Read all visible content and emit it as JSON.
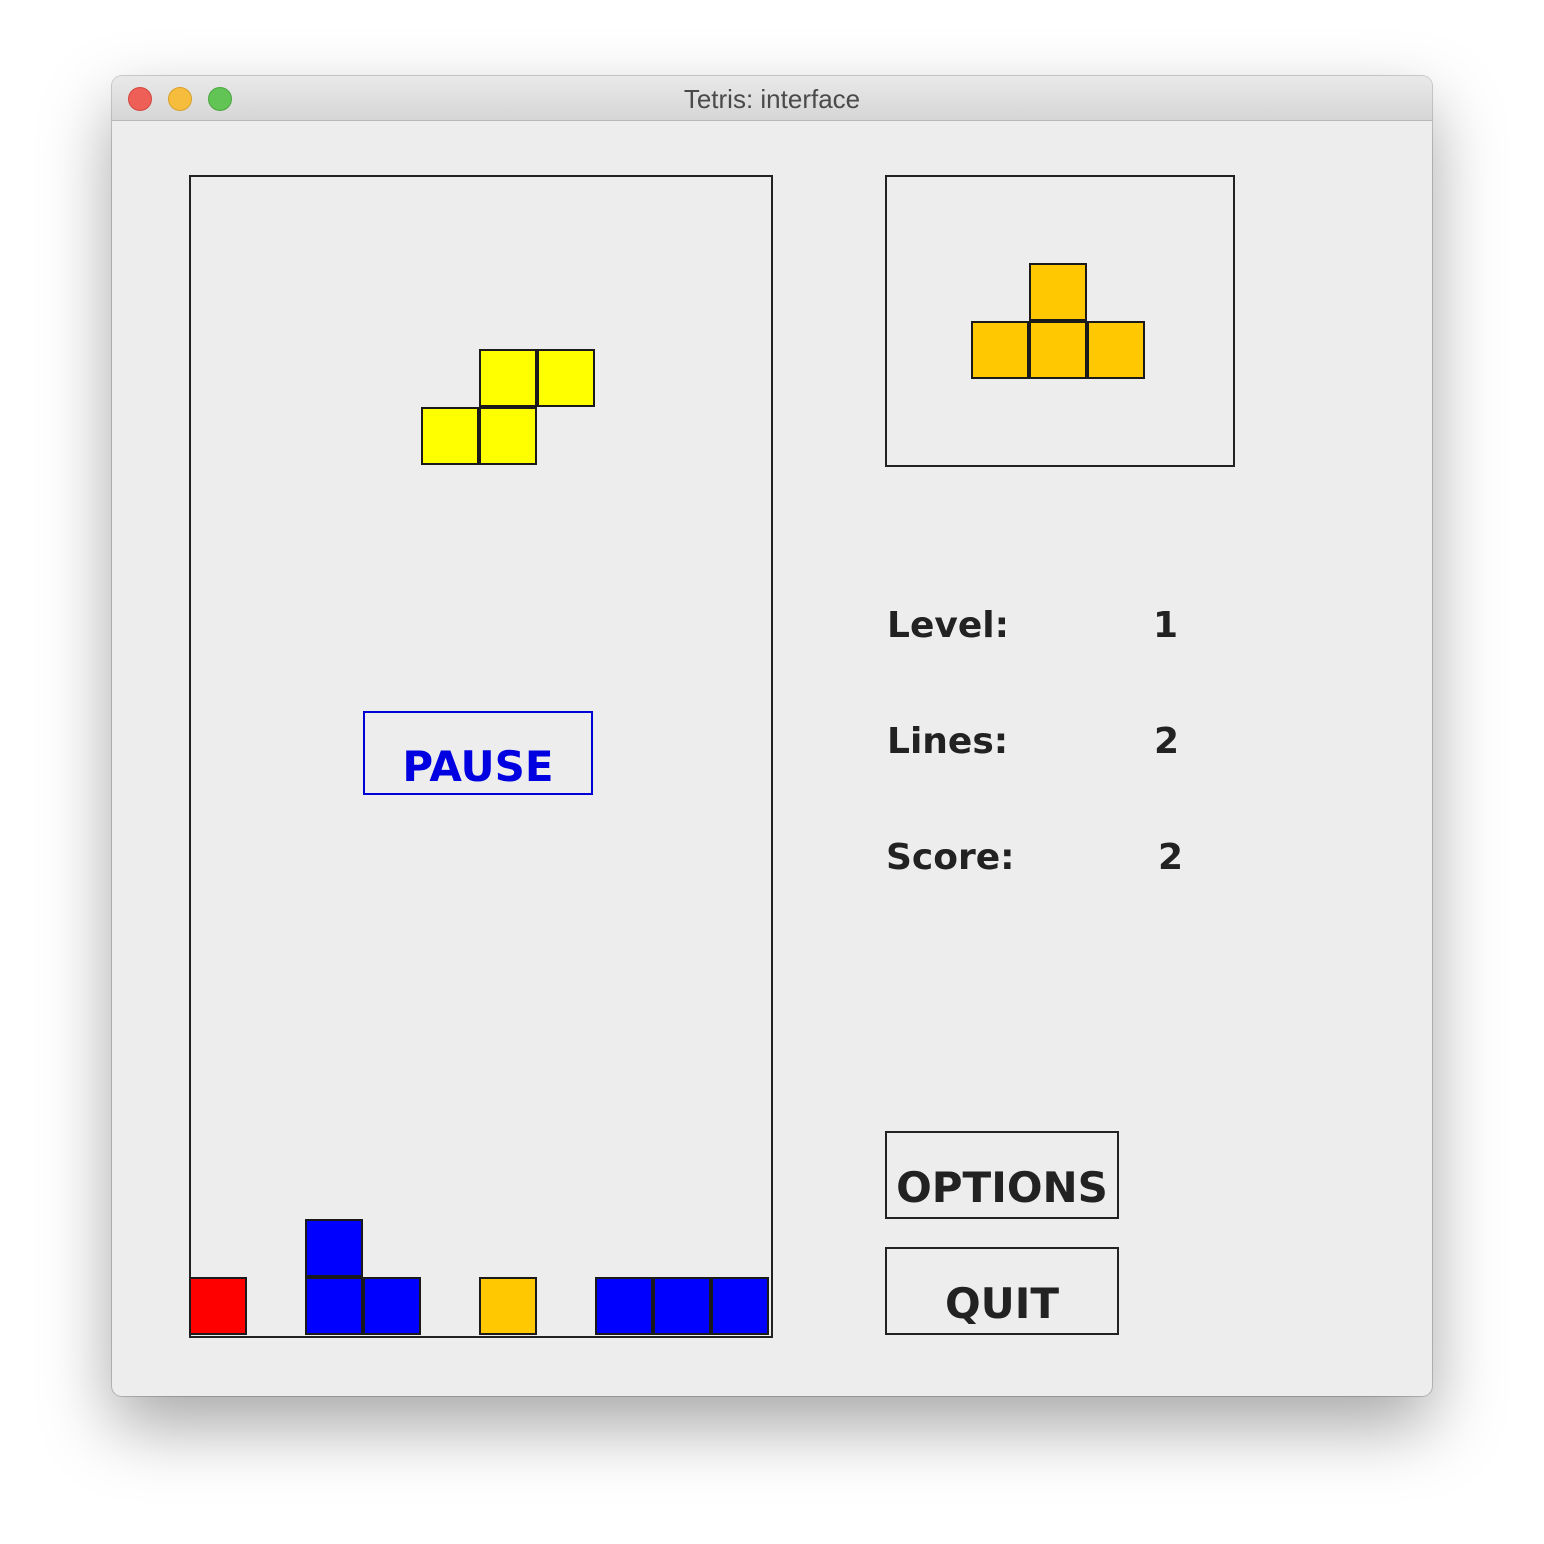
{
  "window": {
    "title": "Tetris: interface"
  },
  "game": {
    "pause_label": "PAUSE",
    "pause_color": "#0000e0"
  },
  "stats": {
    "level_label": "Level:",
    "level_value": "1",
    "lines_label": "Lines:",
    "lines_value": "2",
    "score_label": "Score:",
    "score_value": "2"
  },
  "buttons": {
    "options_label": "OPTIONS",
    "quit_label": "QUIT"
  },
  "colors": {
    "falling_piece": "#ffff00",
    "next_piece": "#ffc800",
    "red_block": "#ff0000",
    "blue_block": "#0000ff",
    "orange_block": "#ffc800"
  },
  "pieces": {
    "falling": {
      "shape": "S",
      "color": "#ffff00"
    },
    "next": {
      "shape": "T",
      "color": "#ffc800"
    }
  }
}
